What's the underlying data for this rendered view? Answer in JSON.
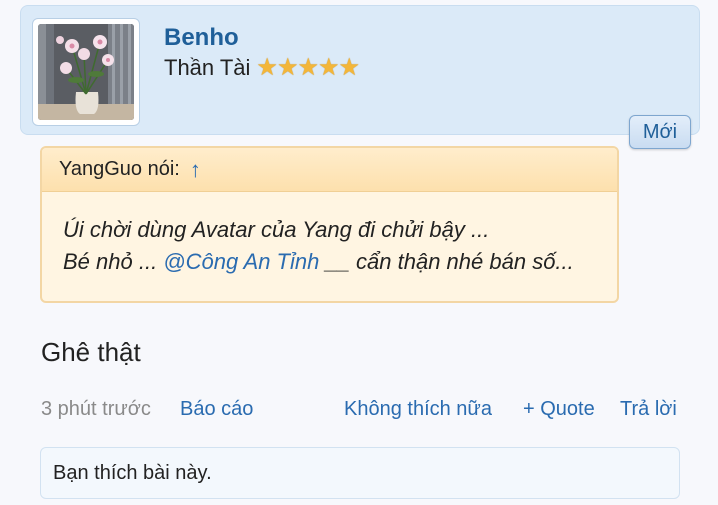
{
  "user": {
    "name": "Benho",
    "title": "Thần Tài",
    "rating_stars": 5,
    "avatar_icon": "lily-flowers-vase-photo"
  },
  "badge": {
    "label": "Mới"
  },
  "quote": {
    "author": "YangGuo nói:",
    "jump_arrow": "↑",
    "line1": "Úi chời dùng Avatar của Yang đi chửi bậy ...",
    "line2_before": "Bé nhỏ ... ",
    "mention": "@Công An Tỉnh",
    "line2_after": " __ cẩn thận nhé bán số..."
  },
  "message": {
    "text": "Ghê thật"
  },
  "meta": {
    "time": "3 phút trước",
    "report": "Báo cáo",
    "unlike": "Không thích nữa",
    "quote": "+ Quote",
    "reply": "Trả lời"
  },
  "likes": {
    "text": "Bạn thích bài này."
  },
  "colors": {
    "accent": "#1f5f99",
    "link": "#2a6bb0",
    "card_bg": "#dbeaf8",
    "quote_bg": "#fff5e2",
    "star": "#f3b63a"
  }
}
